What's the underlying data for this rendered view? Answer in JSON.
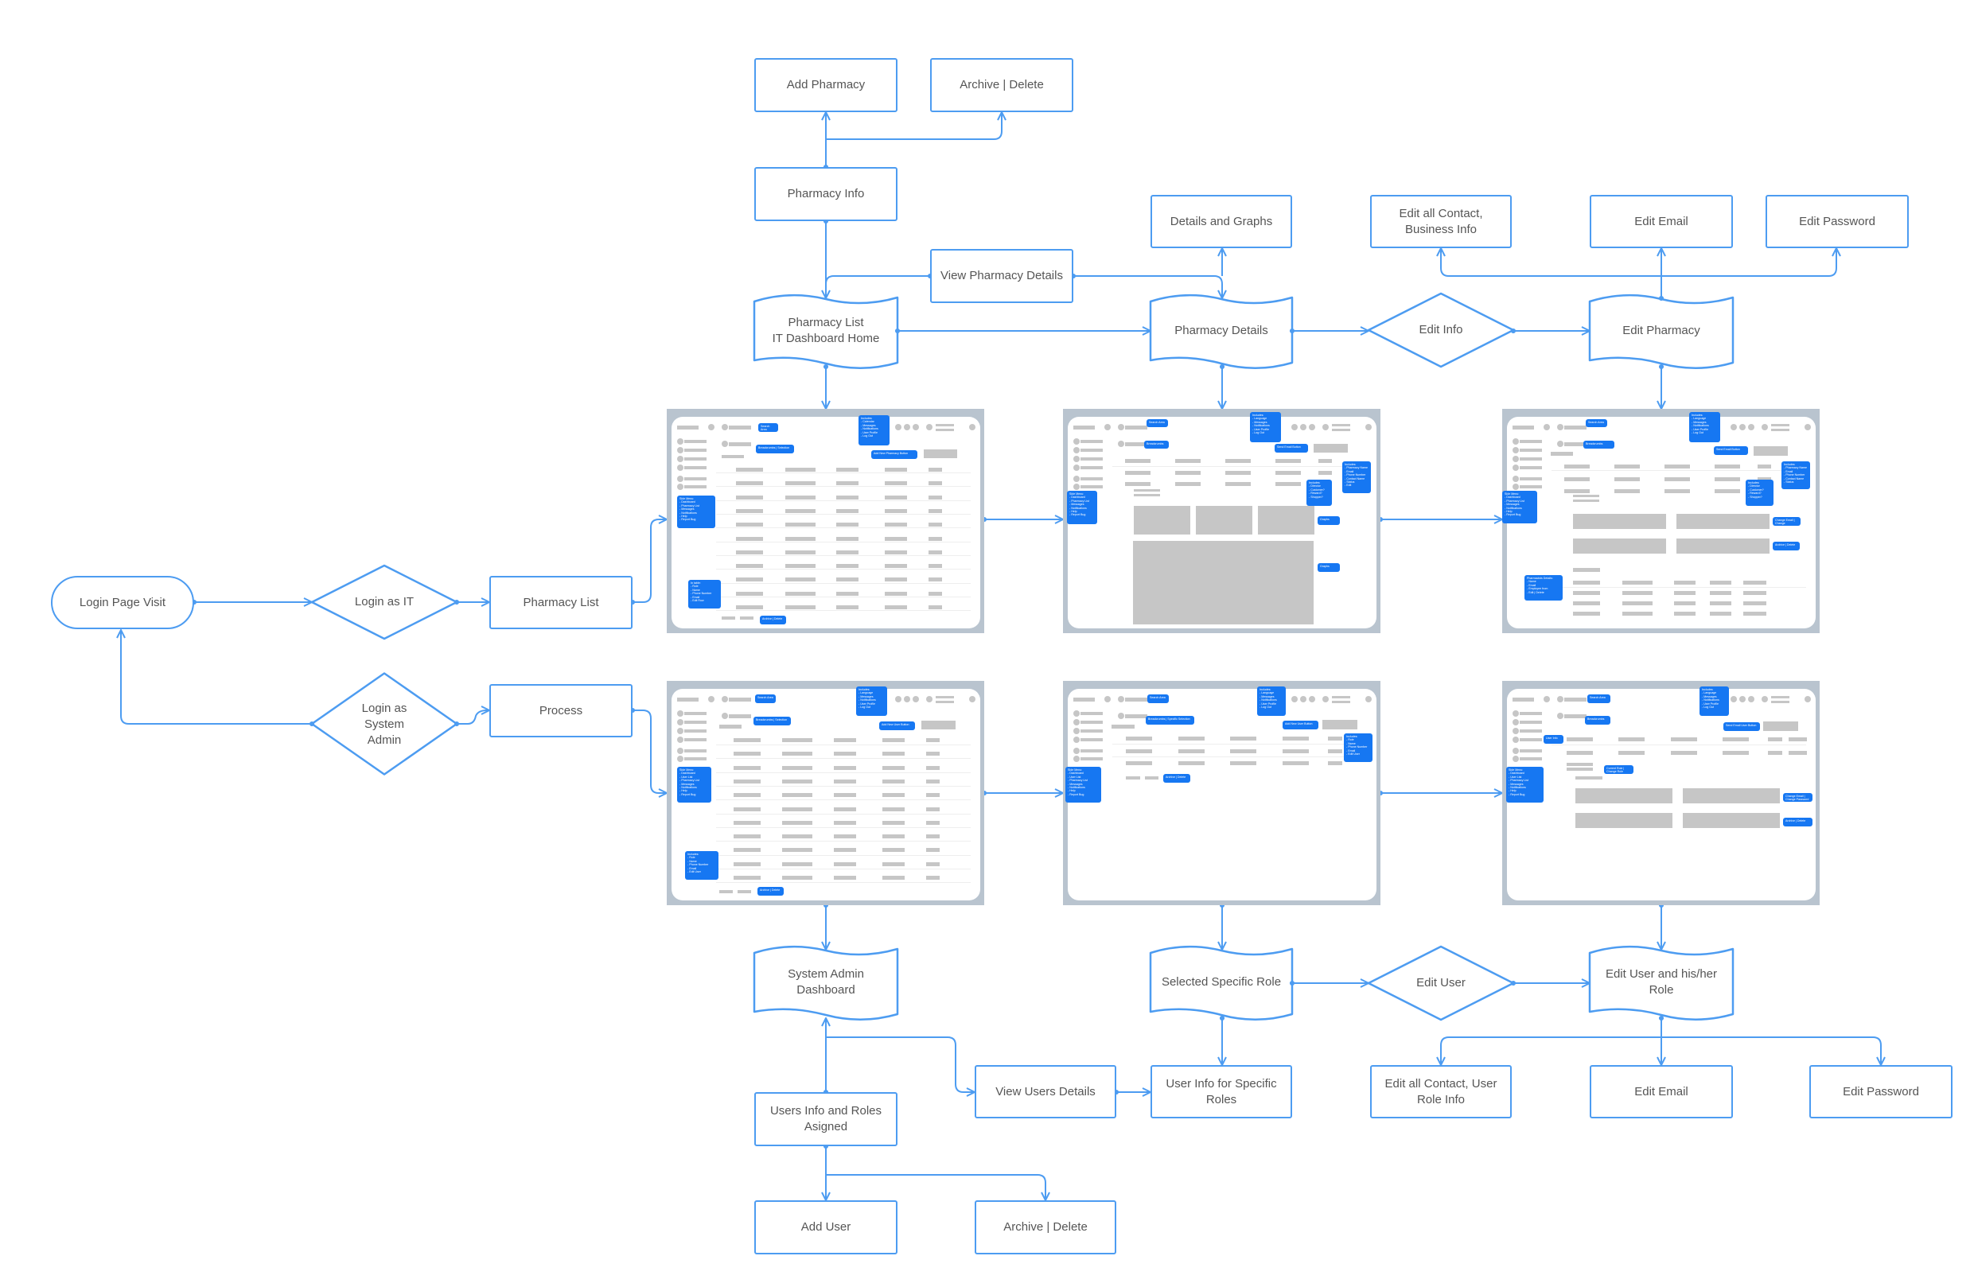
{
  "colors": {
    "connector": "#4d9cf1",
    "callout": "#1677f2",
    "frame": "#b9c4cf",
    "placeholder": "#c6c6c6",
    "text": "#555555"
  },
  "nodes": {
    "add_pharmacy": "Add Pharmacy",
    "archive_delete_pharmacy": "Archive | Delete",
    "pharmacy_info": "Pharmacy Info",
    "view_pharmacy_details": "View Pharmacy Details",
    "details_and_graphs": "Details and Graphs",
    "edit_contact_business": "Edit all Contact,\nBusiness Info",
    "edit_email_top": "Edit Email",
    "edit_password_top": "Edit Password",
    "pharmacy_list_home": "Pharmacy List\nIT Dashboard Home",
    "pharmacy_details": "Pharmacy Details",
    "edit_info": "Edit Info",
    "edit_pharmacy": "Edit Pharmacy",
    "login_page_visit": "Login Page Visit",
    "login_as_it": "Login as IT",
    "pharmacy_list": "Pharmacy List",
    "login_as_system_admin": "Login as\nSystem\nAdmin",
    "process": "Process",
    "system_admin_dashboard": "System Admin\nDashboard",
    "selected_specific_role": "Selected Specific Role",
    "edit_user": "Edit User",
    "edit_user_role": "Edit User and his/her\nRole",
    "users_info_roles": "Users Info and Roles\nAsigned",
    "view_users_details": "View Users Details",
    "user_info_specific_roles": "User Info for Specific\nRoles",
    "edit_contact_user_role": "Edit all Contact, User\nRole Info",
    "edit_email_bottom": "Edit Email",
    "edit_password_bottom": "Edit Password",
    "add_user": "Add User",
    "archive_delete_user": "Archive | Delete"
  },
  "thumbs": [
    {
      "name": "pharmacy-list-wireframe",
      "callouts": [
        "Search Area",
        "Includes:\n- Calendar\n- Messages\n- Notifications\n- User Profile\n- Log Out",
        "Breadcrumbs | Selection",
        "Add New Pharmacy Button",
        "Side Menu:\n- Dashboard\n- Pharmacy List\n- Messages\n- Notifications\n- Help\n- Report Bug",
        "In table:\n- Role\n- Name\n- Phone Number\n- Email\n- Edit Row",
        "Archive | Delete"
      ]
    },
    {
      "name": "pharmacy-details-wireframe",
      "callouts": [
        "Search Area",
        "Includes:\n- Language\n- Messages\n- Notifications\n- User Profile\n- Log Out",
        "Breadcrumbs",
        "Send Email Button",
        "Side Menu:\n- Dashboard\n- Pharmacy List\n- Messages\n- Notifications\n- Help\n- Report Bug",
        "Includes:\n- Pharmacy Name\n- Email\n- Phone Number\n- Contact Name\n- Status\n- Edit",
        "Includes:\n- Director\n- Customer?\n- Reward?\n- Shopper?",
        "Graphs",
        "Graphs"
      ]
    },
    {
      "name": "edit-pharmacy-wireframe",
      "callouts": [
        "Search Area",
        "Includes:\n- Language\n- Messages\n- Notifications\n- User Profile\n- Log Out",
        "Breadcrumbs",
        "Send Email Button",
        "Side Menu:\n- Dashboard\n- Pharmacy List\n- Messages\n- Notifications\n- Help\n- Report Bug",
        "Includes:\n- Pharmacy Name\n- Email\n- Phone Number\n- Contact Name\n- Status",
        "Includes:\n- Director\n- Customer?\n- Reward?\n- Shopper?",
        "Change Email | Change Password",
        "Archive | Delete",
        "Pharmacists Details:\n- Name\n- Email\n- Employee from\n- Edit | Delete"
      ]
    },
    {
      "name": "system-admin-dashboard-wireframe",
      "callouts": [
        "Search Area",
        "Includes:\n- Language\n- Messages\n- Notifications\n- User Profile\n- Log Out",
        "Breadcrumbs | Selection",
        "Add New User Button",
        "Side Menu:\n- Dashboard\n- User List\n- Pharmacy List\n- Messages\n- Notifications\n- Help\n- Report Bug",
        "Includes:\n- Role\n- Name\n- Phone Number\n- Email\n- Edit User",
        "Archive | Delete"
      ]
    },
    {
      "name": "specific-role-wireframe",
      "callouts": [
        "Search Area",
        "Includes:\n- Language\n- Messages\n- Notifications\n- User Profile\n- Log Out",
        "Breadcrumbs | Specific Selection",
        "Add New User Button",
        "Side Menu:\n- Dashboard\n- User List\n- Pharmacy List\n- Messages\n- Notifications\n- Help\n- Report Bug",
        "Includes:\n- Role\n- Name\n- Phone Number\n- Email\n- Edit User",
        "Archive | Delete"
      ]
    },
    {
      "name": "edit-user-wireframe",
      "callouts": [
        "Search Area",
        "Includes:\n- Language\n- Messages\n- Notifications\n- User Profile\n- Log Out",
        "Breadcrumbs",
        "Send Email User Button",
        "Side Menu:\n- Dashboard\n- User List\n- Pharmacy List\n- Messages\n- Notifications\n- Help\n- Report Bug",
        "User Info",
        "Current Role | Change Role button",
        "Change Email | Change Password",
        "Archive | Delete"
      ]
    }
  ]
}
